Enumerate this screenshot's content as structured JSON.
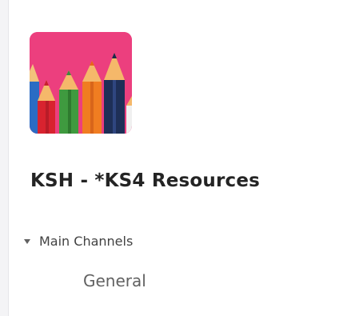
{
  "team": {
    "name": "KSH - *KS4 Resources",
    "avatar_icon": "colored-pencils-image",
    "avatar_bg": "#ec3f7e"
  },
  "channels": {
    "section_label": "Main Channels",
    "section_icon": "caret-down-icon",
    "expanded": true,
    "items": [
      {
        "label": "General"
      }
    ]
  }
}
